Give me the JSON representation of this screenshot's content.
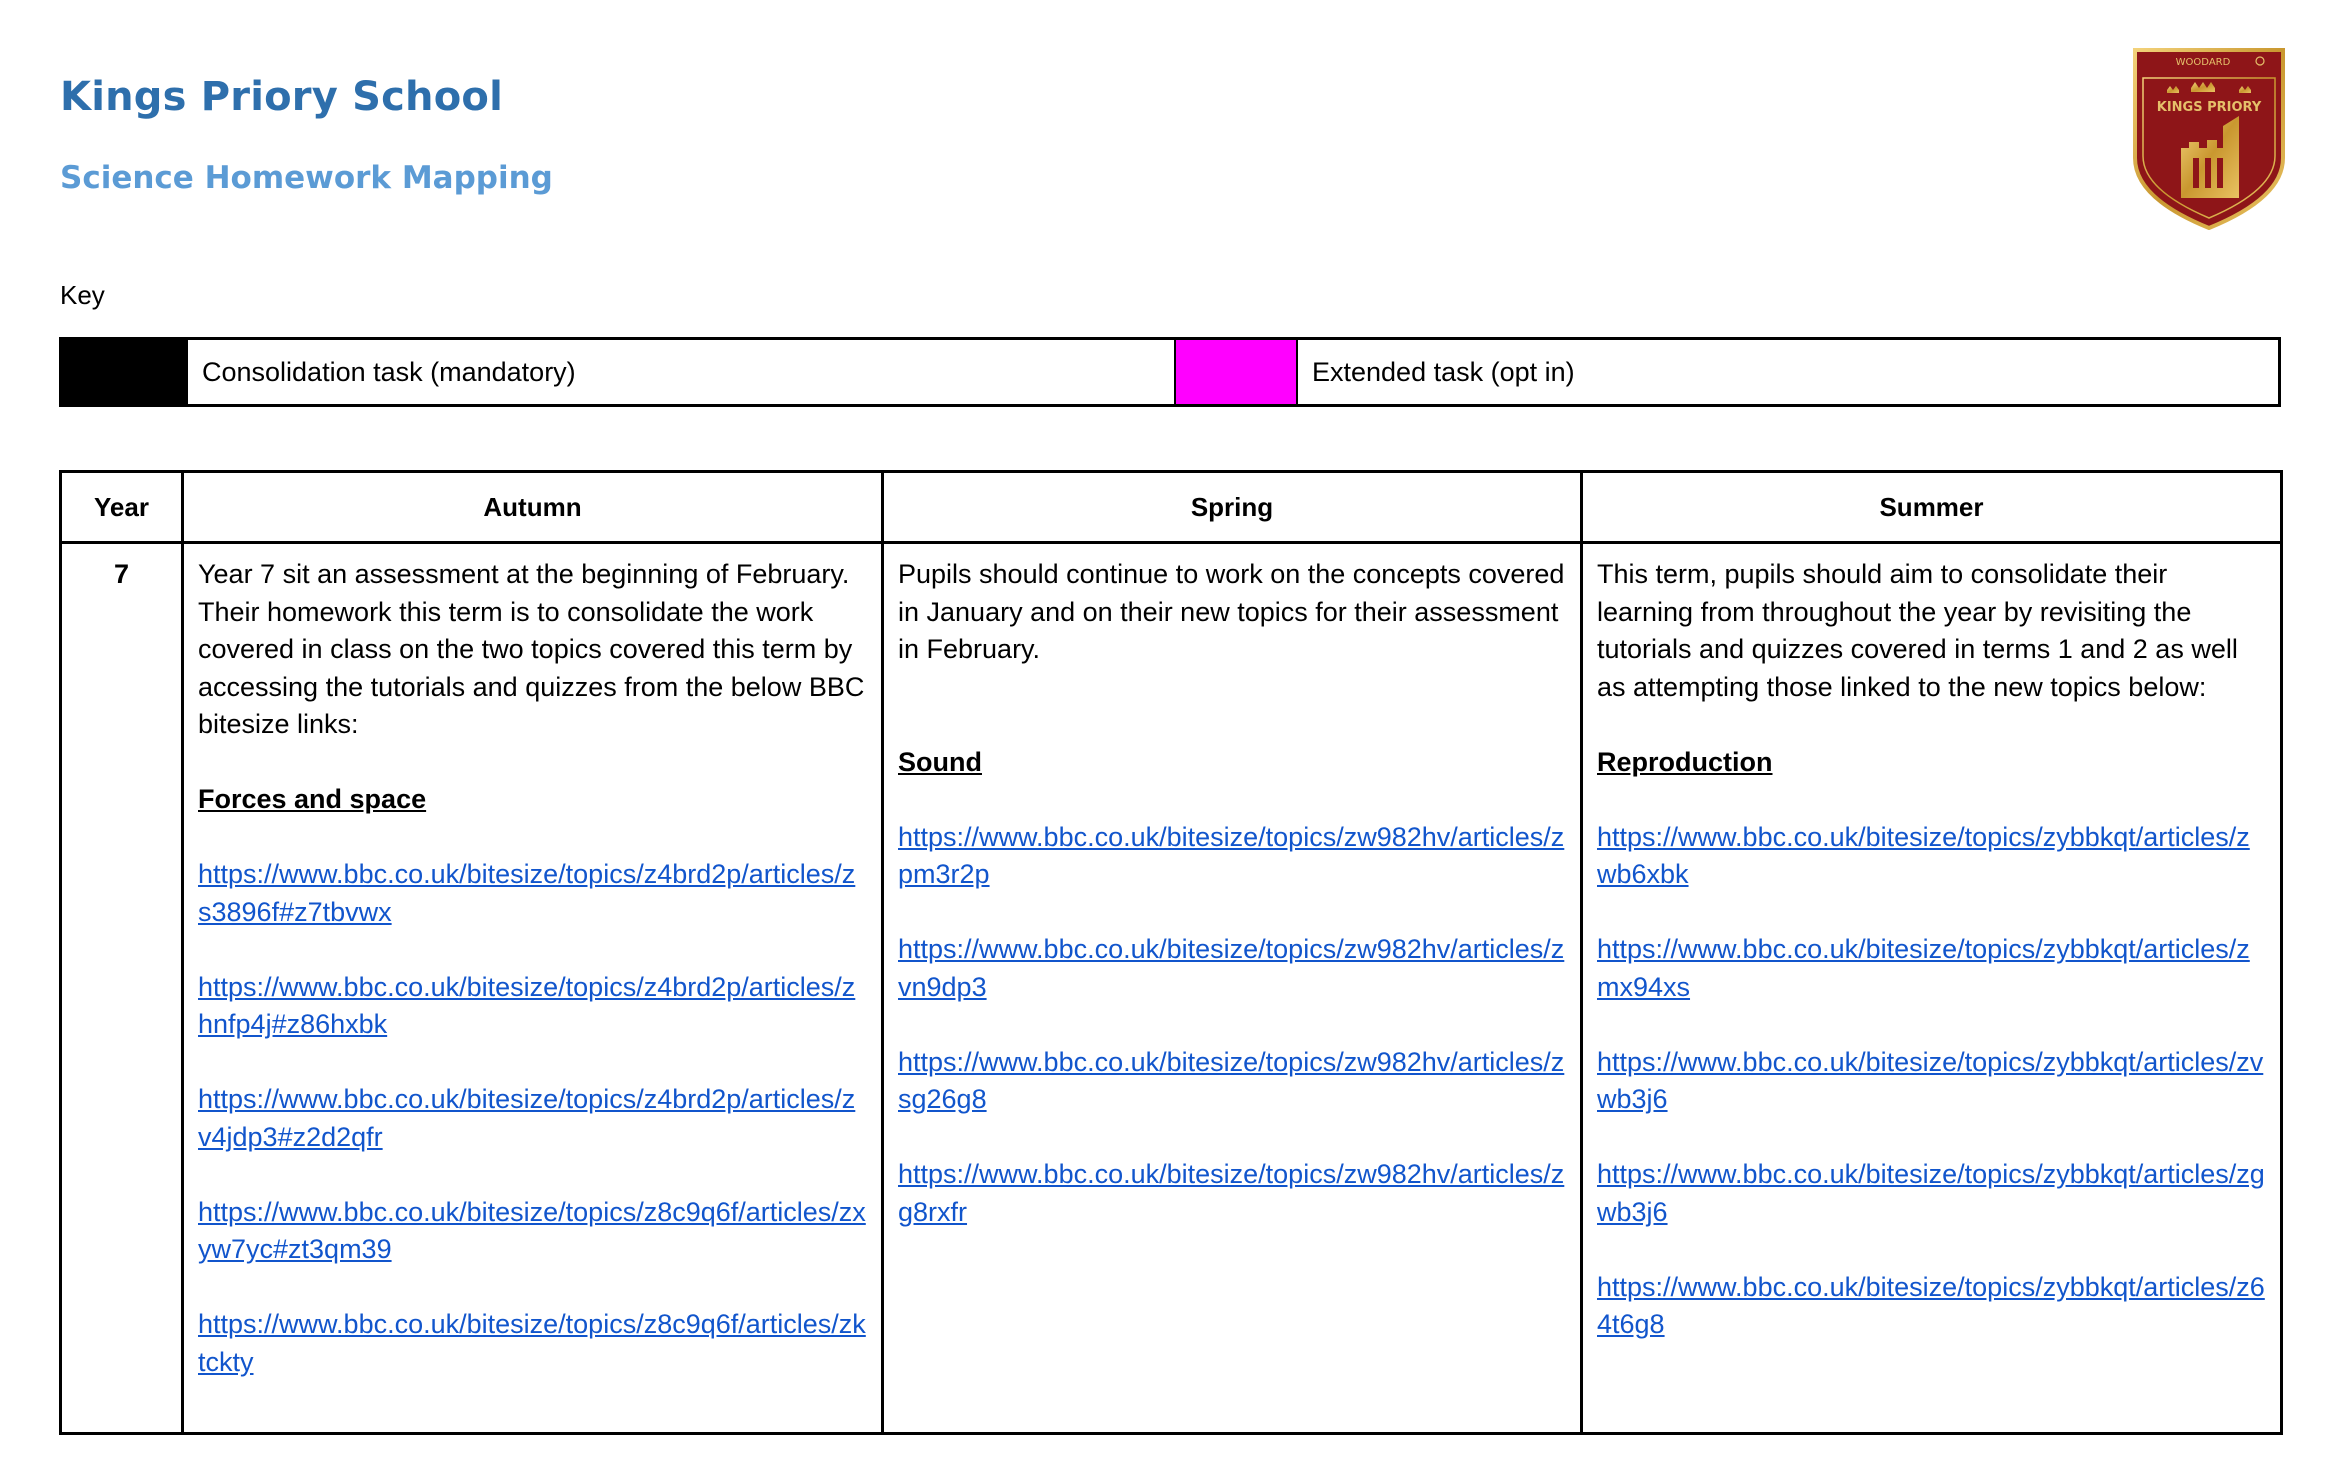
{
  "header": {
    "title": "Kings Priory School",
    "subtitle": "Science Homework Mapping",
    "crest": {
      "top_text": "WOODARD",
      "name": "KINGS PRIORY"
    }
  },
  "key": {
    "label": "Key",
    "items": [
      {
        "color": "#000000",
        "text": "Consolidation task (mandatory)"
      },
      {
        "color": "#ff00ff",
        "text": "Extended task (opt in)"
      }
    ]
  },
  "table": {
    "headers": [
      "Year",
      "Autumn",
      "Spring",
      "Summer"
    ],
    "rows": [
      {
        "year": "7",
        "autumn": {
          "intro": "Year 7 sit an assessment  at the beginning of February. Their homework this term is to consolidate the work covered in class on the two  topics covered this term by accessing the tutorials and quizzes from the below BBC bitesize links:",
          "topic": "Forces and space",
          "links": [
            "https://www.bbc.co.uk/bitesize/topics/z4brd2p/articles/zs3896f#z7tbvwx",
            "https://www.bbc.co.uk/bitesize/topics/z4brd2p/articles/zhnfp4j#z86hxbk",
            "https://www.bbc.co.uk/bitesize/topics/z4brd2p/articles/zv4jdp3#z2d2qfr",
            "https://www.bbc.co.uk/bitesize/topics/z8c9q6f/articles/zxyw7yc#zt3qm39",
            "https://www.bbc.co.uk/bitesize/topics/z8c9q6f/articles/zktckty"
          ]
        },
        "spring": {
          "intro": "Pupils should continue to work on the concepts covered in January and on their new topics for their assessment  in February.",
          "topic": "Sound",
          "links": [
            "https://www.bbc.co.uk/bitesize/topics/zw982hv/articles/zpm3r2p",
            "https://www.bbc.co.uk/bitesize/topics/zw982hv/articles/zvn9dp3",
            "https://www.bbc.co.uk/bitesize/topics/zw982hv/articles/zsg26g8",
            "https://www.bbc.co.uk/bitesize/topics/zw982hv/articles/zg8rxfr"
          ]
        },
        "summer": {
          "intro": "This term, pupils should aim to consolidate their learning from throughout the year by revisiting the tutorials and quizzes covered in terms 1 and 2 as well as attempting those linked to the new topics below:",
          "topic": "Reproduction",
          "links": [
            "https://www.bbc.co.uk/bitesize/topics/zybbkqt/articles/zwb6xbk",
            "https://www.bbc.co.uk/bitesize/topics/zybbkqt/articles/zmx94xs",
            "https://www.bbc.co.uk/bitesize/topics/zybbkqt/articles/zvwb3j6",
            "https://www.bbc.co.uk/bitesize/topics/zybbkqt/articles/zgwb3j6",
            "https://www.bbc.co.uk/bitesize/topics/zybbkqt/articles/z64t6g8"
          ]
        }
      }
    ]
  }
}
